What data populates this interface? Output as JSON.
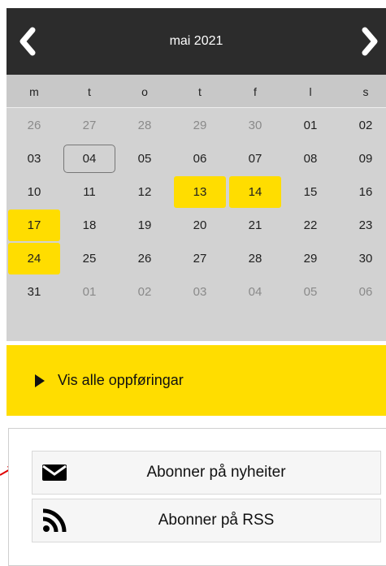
{
  "calendar": {
    "month_title": "mai 2021",
    "prev_icon": "chevron-left-icon",
    "next_icon": "chevron-right-icon",
    "weekdays": [
      "m",
      "t",
      "o",
      "t",
      "f",
      "l",
      "s"
    ],
    "weeks": [
      [
        {
          "d": "26",
          "other": true
        },
        {
          "d": "27",
          "other": true
        },
        {
          "d": "28",
          "other": true
        },
        {
          "d": "29",
          "other": true
        },
        {
          "d": "30",
          "other": true
        },
        {
          "d": "01"
        },
        {
          "d": "02"
        }
      ],
      [
        {
          "d": "03"
        },
        {
          "d": "04",
          "today": true
        },
        {
          "d": "05"
        },
        {
          "d": "06"
        },
        {
          "d": "07"
        },
        {
          "d": "08"
        },
        {
          "d": "09"
        }
      ],
      [
        {
          "d": "10"
        },
        {
          "d": "11"
        },
        {
          "d": "12"
        },
        {
          "d": "13",
          "hl": true
        },
        {
          "d": "14",
          "hl": true
        },
        {
          "d": "15"
        },
        {
          "d": "16"
        }
      ],
      [
        {
          "d": "17",
          "hl": true
        },
        {
          "d": "18"
        },
        {
          "d": "19"
        },
        {
          "d": "20"
        },
        {
          "d": "21"
        },
        {
          "d": "22"
        },
        {
          "d": "23"
        }
      ],
      [
        {
          "d": "24",
          "hl": true
        },
        {
          "d": "25"
        },
        {
          "d": "26"
        },
        {
          "d": "27"
        },
        {
          "d": "28"
        },
        {
          "d": "29"
        },
        {
          "d": "30"
        }
      ],
      [
        {
          "d": "31"
        },
        {
          "d": "01",
          "other": true
        },
        {
          "d": "02",
          "other": true
        },
        {
          "d": "03",
          "other": true
        },
        {
          "d": "04",
          "other": true
        },
        {
          "d": "05",
          "other": true
        },
        {
          "d": "06",
          "other": true
        }
      ]
    ],
    "highlight_color": "#ffdd00"
  },
  "show_all": {
    "label": "Vis alle oppføringar",
    "icon": "play-triangle-icon"
  },
  "subscribe": {
    "newsletter_label": "Abonner på nyheiter",
    "newsletter_icon": "envelope-icon",
    "rss_label": "Abonner på RSS",
    "rss_icon": "rss-icon"
  }
}
